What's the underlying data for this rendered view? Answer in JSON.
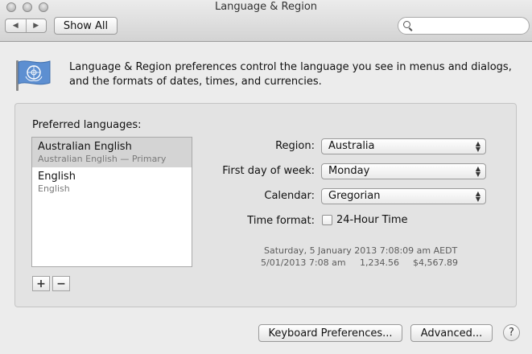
{
  "window": {
    "title": "Language & Region",
    "show_all": "Show All",
    "back_glyph": "◀",
    "forward_glyph": "▶"
  },
  "search": {
    "value": "",
    "placeholder": ""
  },
  "intro": {
    "icon": "un-flag-icon",
    "text": "Language & Region preferences control the language you see in menus and dialogs, and the formats of dates, times, and currencies."
  },
  "preferred_languages": {
    "label": "Preferred languages:",
    "items": [
      {
        "name": "Australian English",
        "detail": "Australian English — Primary",
        "selected": true
      },
      {
        "name": "English",
        "detail": "English",
        "selected": false
      }
    ],
    "add_label": "+",
    "remove_label": "−"
  },
  "settings": {
    "region": {
      "label": "Region:",
      "value": "Australia"
    },
    "first_day": {
      "label": "First day of week:",
      "value": "Monday"
    },
    "calendar": {
      "label": "Calendar:",
      "value": "Gregorian"
    },
    "time_format": {
      "label": "Time format:",
      "checkbox_label": "24-Hour Time",
      "checked": false
    }
  },
  "sample": {
    "datetime": "Saturday, 5 January 2013 7:08:09 am AEDT",
    "short_date": "5/01/2013 7:08 am",
    "number": "1,234.56",
    "currency": "$4,567.89"
  },
  "footer": {
    "keyboard_button": "Keyboard Preferences...",
    "advanced_button": "Advanced...",
    "help_label": "?"
  }
}
